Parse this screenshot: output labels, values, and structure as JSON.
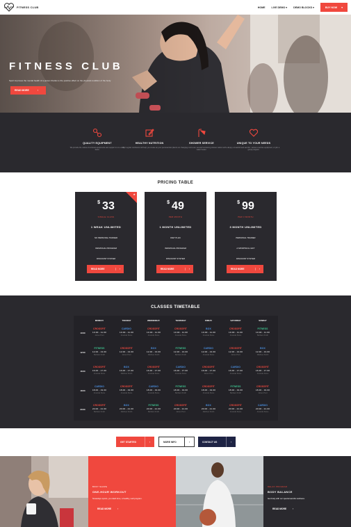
{
  "nav": {
    "brand": "FITNESS CLUB",
    "links": [
      "HOME",
      "LIVE DEMO",
      "DEMO BLOCKS"
    ],
    "buy_label": "BUY NOW"
  },
  "hero": {
    "title": "FITNESS CLUB",
    "subtitle": "Sport improves the mental health of a person thanks to the positive effect on the physical condition of the body",
    "button": "READ MORE"
  },
  "features": [
    {
      "icon": "dumbbell-icon",
      "title": "QUALITY EQUIPMENT",
      "text": "We provide the various functional equipments and support in on a daily basis."
    },
    {
      "icon": "notepad-icon",
      "title": "HEALTHY NUTRITION",
      "text": "Our regular nutritionist will help you create an your personal diet plan."
    },
    {
      "icon": "shower-icon",
      "title": "SHOWER SERVICE",
      "text": "In our changing rooms are several functioning shower cabins with a water heater."
    },
    {
      "icon": "heart-icon",
      "title": "UNIQUE TO YOUR NEEDS",
      "text": "Enjoy a treadmill and aerobic, various exercise equipment, or join a group program."
    }
  ],
  "pricing": {
    "title": "PRICING TABLE",
    "plans": [
      {
        "currency": "$",
        "price": "33",
        "period": "SINGLE CLASS",
        "name": "1 WEAK UNLIMITED",
        "features": [
          "NO PERSONAL TRAINER",
          "INDIVIDUAL PROGRAM",
          "DISCOUNT SYSTEM"
        ],
        "button": "READ MORE"
      },
      {
        "currency": "$",
        "price": "49",
        "period": "PER MONTH",
        "name": "1 MONTH UNLIMITED",
        "features": [
          "DIET PLAN",
          "INDIVIDUAL PROGRAM",
          "DISCOUNT SYSTEM"
        ],
        "button": "READ MORE"
      },
      {
        "currency": "$",
        "price": "99",
        "period": "PER 3 MONTH",
        "name": "3 MONTH UNLIMITED",
        "features": [
          "PERSONAL TRAINER",
          "A SPORTSFUL GIFT",
          "DISCOUNT SYSTEM"
        ],
        "button": "READ MORE"
      }
    ]
  },
  "timetable": {
    "title": "CLASSES TIMETABLE",
    "days": [
      "MONDAY",
      "TUESDAY",
      "WEDNESDAY",
      "THURSDAY",
      "FRIDAY",
      "SATURDAY",
      "SUNDAY"
    ],
    "times": [
      "10:00",
      "12:00",
      "16:00",
      "18:00",
      "20:00"
    ],
    "colors": {
      "CROSSFIT": "#f0483e",
      "CARDIO": "#4a90e2",
      "BOX": "#4a90e2",
      "FITNESS": "#3ec490"
    },
    "rows": [
      [
        {
          "name": "CROSSFIT",
          "time": "10.00 - 11.00",
          "trainer": "James Hunt"
        },
        {
          "name": "CARDIO",
          "time": "10.00 - 11.00",
          "trainer": "Amanda Stone"
        },
        {
          "name": "CROSSFIT",
          "time": "10.00 - 11.00",
          "trainer": "Amanda Stone"
        },
        {
          "name": "CROSSFIT",
          "time": "10.00 - 11.00",
          "trainer": "Amanda Stone"
        },
        {
          "name": "BOX",
          "time": "10.00 - 11.00",
          "trainer": "Amanda Stone"
        },
        {
          "name": "CROSSFIT",
          "time": "10.00 - 11.00",
          "trainer": "Amanda Stone"
        },
        {
          "name": "FITNESS",
          "time": "10.00 - 11.00",
          "trainer": "Barbara Smith"
        }
      ],
      [
        {
          "name": "FITNESS",
          "time": "12.00 - 13.00",
          "trainer": "Barbara Smith"
        },
        {
          "name": "CROSSFIT",
          "time": "12.00 - 13.00",
          "trainer": "James Hunt"
        },
        {
          "name": "BOX",
          "time": "12.00 - 13.00",
          "trainer": "Matthew Smith"
        },
        {
          "name": "FITNESS",
          "time": "12.00 - 13.00",
          "trainer": "Barbara Smith"
        },
        {
          "name": "CARDIO",
          "time": "12.00 - 13.00",
          "trainer": "Amanda Stone"
        },
        {
          "name": "CROSSFIT",
          "time": "12.00 - 13.00",
          "trainer": "James Hunt"
        },
        {
          "name": "BOX",
          "time": "12.00 - 13.00",
          "trainer": "Matthew Smith"
        }
      ],
      [
        {
          "name": "CROSSFIT",
          "time": "16.00 - 17.00",
          "trainer": "Amanda Stone"
        },
        {
          "name": "BOX",
          "time": "16.00 - 17.00",
          "trainer": "Matthew Smith"
        },
        {
          "name": "CROSSFIT",
          "time": "16.00 - 17.00",
          "trainer": "Amanda Stone"
        },
        {
          "name": "CARDIO",
          "time": "16.00 - 17.00",
          "trainer": "Amanda Stone"
        },
        {
          "name": "CROSSFIT",
          "time": "16.00 - 17.00",
          "trainer": "James Hunt"
        },
        {
          "name": "CARDIO",
          "time": "16.00 - 17.00",
          "trainer": "Amanda Stone"
        },
        {
          "name": "CROSSFIT",
          "time": "16.00 - 17.00",
          "trainer": "Amanda Stone"
        }
      ],
      [
        {
          "name": "CARDIO",
          "time": "18.00 - 19.00",
          "trainer": "Amanda Stone"
        },
        {
          "name": "CROSSFIT",
          "time": "18.00 - 19.00",
          "trainer": "Amanda Stone"
        },
        {
          "name": "CARDIO",
          "time": "18.00 - 19.00",
          "trainer": "Amanda Stone"
        },
        {
          "name": "FITNESS",
          "time": "18.00 - 19.00",
          "trainer": "Barbara Smith"
        },
        {
          "name": "CROSSFIT",
          "time": "18.00 - 19.00",
          "trainer": "Amanda Stone"
        },
        {
          "name": "FITNESS",
          "time": "18.00 - 19.00",
          "trainer": "Barbara Smith"
        },
        {
          "name": "CROSSFIT",
          "time": "18.00 - 19.00",
          "trainer": "James Hunt"
        }
      ],
      [
        {
          "name": "CROSSFIT",
          "time": "20.00 - 21.00",
          "trainer": "Barbara Smith"
        },
        {
          "name": "BOX",
          "time": "20.00 - 21.00",
          "trainer": "Matthew Smith"
        },
        {
          "name": "FITNESS",
          "time": "20.00 - 21.00",
          "trainer": "Barbara Smith"
        },
        {
          "name": "CROSSFIT",
          "time": "20.00 - 21.00",
          "trainer": "James Hunt"
        },
        {
          "name": "BOX",
          "time": "20.00 - 21.00",
          "trainer": "Matthew Smith"
        },
        {
          "name": "CROSSFIT",
          "time": "20.00 - 21.00",
          "trainer": "Amanda Stone"
        },
        {
          "name": "CARDIO",
          "time": "20.00 - 21.00",
          "trainer": "Amanda Stone"
        }
      ]
    ]
  },
  "cta": {
    "get_started": "GET STARTED",
    "more_info": "MORE INFO",
    "contact_us": "CONTACT US"
  },
  "bottom": {
    "left": {
      "label": "BODY SHAPE",
      "title": "ONE-HOUR WORKOUT",
      "text": "Nowadays sports, you dash time, a healthy, well program.",
      "button": "READ MORE"
    },
    "right": {
      "label": "RELAX PROGRAM",
      "title": "BODY BALANCE",
      "text": "Get body with our special aerobic wellness.",
      "button": "READ MORE"
    }
  },
  "theme": {
    "accent": "#f0483e",
    "dark": "#2a292e",
    "navy": "#1e2344"
  }
}
